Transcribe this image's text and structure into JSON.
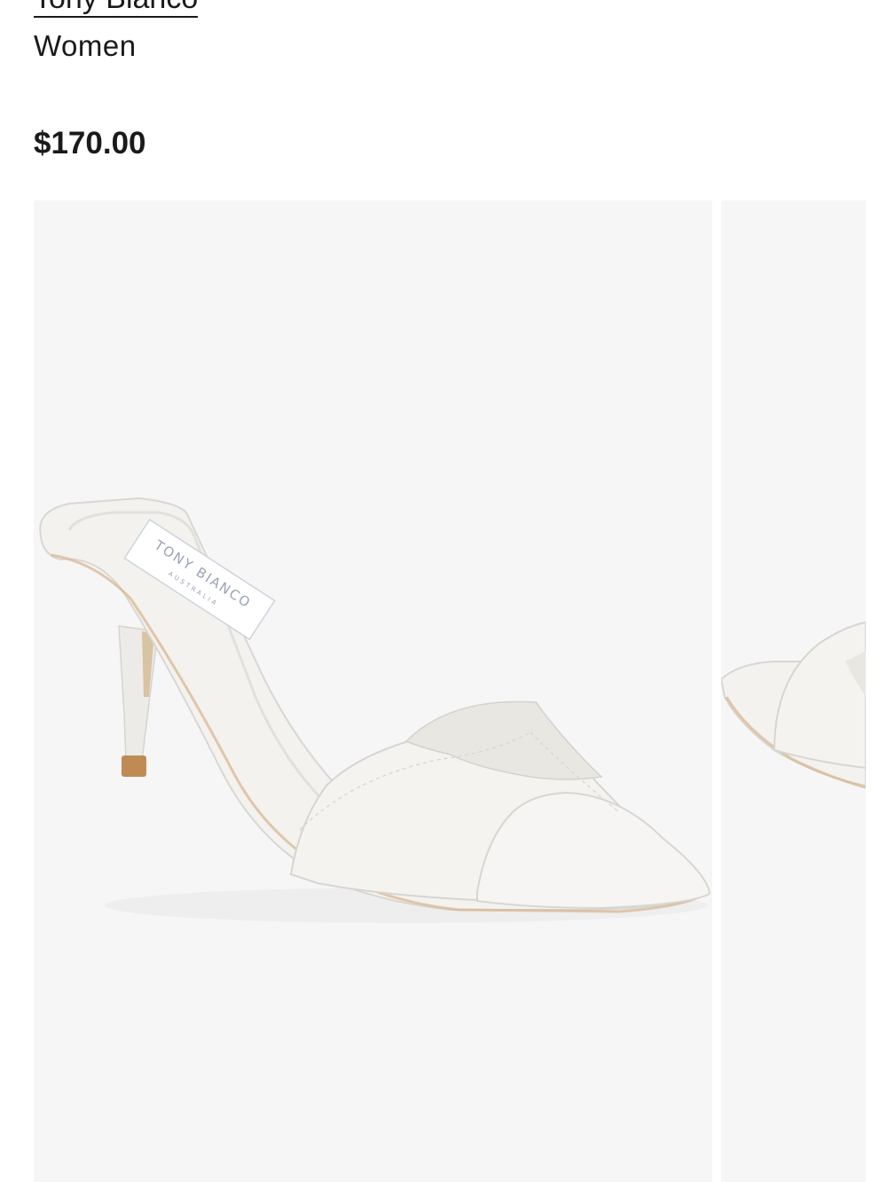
{
  "product": {
    "brand": "Tony Bianco",
    "category": "Women",
    "price": "$170.00"
  },
  "gallery": {
    "main_image": {
      "insole_brand": "TONY BIANCO",
      "insole_sub": "AUSTRALIA",
      "background": "#f6f6f6"
    },
    "next_image": {
      "background": "#f6f6f6"
    }
  },
  "colors": {
    "text": "#1a1a1a",
    "leather": "#f3f2ef",
    "heel_tip": "#c08a55",
    "background": "#f6f6f6"
  }
}
